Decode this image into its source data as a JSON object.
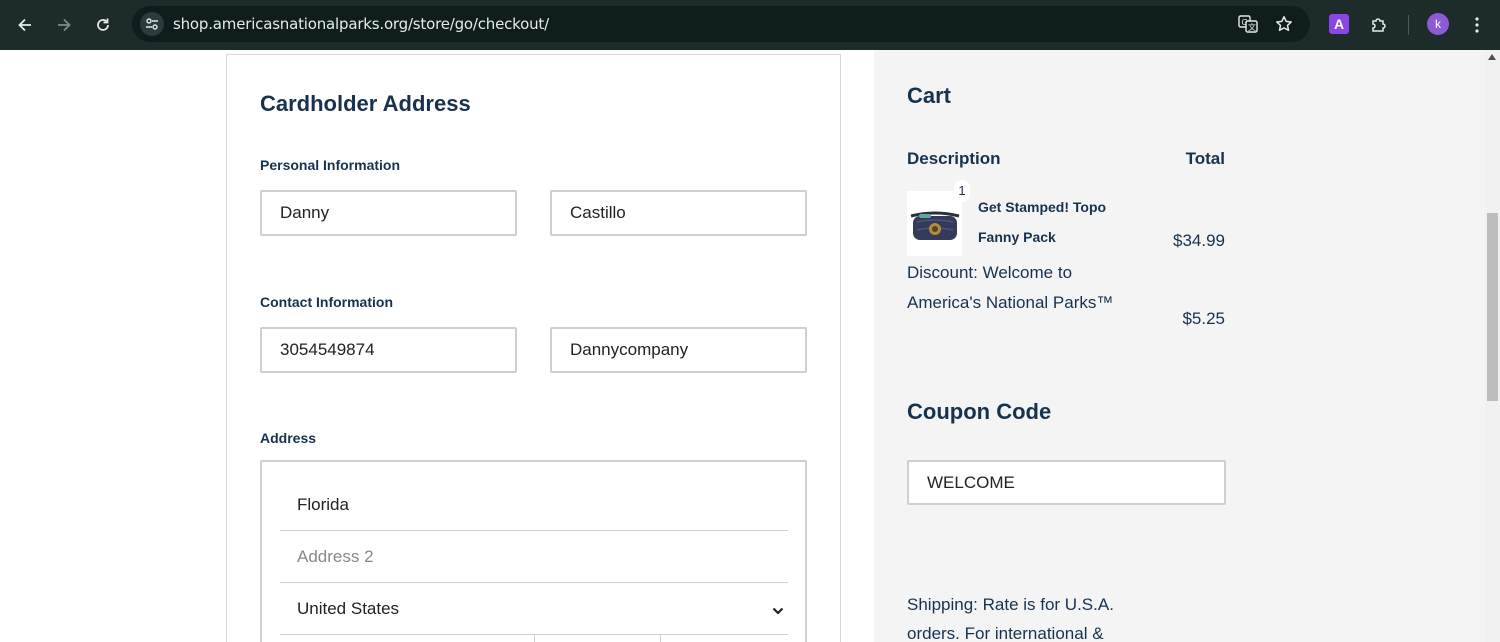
{
  "browser": {
    "url": "shop.americasnationalparks.org/store/go/checkout/",
    "extension_label": "A",
    "profile_initial": "k",
    "icons": [
      "back-icon",
      "forward-icon",
      "reload-icon",
      "site-info-icon",
      "translate-icon",
      "star-icon",
      "extensions-icon",
      "more-menu-icon"
    ]
  },
  "cardholder": {
    "title": "Cardholder Address",
    "personal_label": "Personal Information",
    "first_name": "Danny",
    "last_name": "Castillo",
    "contact_label": "Contact Information",
    "phone": "3054549874",
    "company": "Dannycompany",
    "address_label": "Address",
    "address1": "Florida",
    "address2_placeholder": "Address 2",
    "country": "United States"
  },
  "cart": {
    "title": "Cart",
    "description_header": "Description",
    "total_header": "Total",
    "item": {
      "quantity": "1",
      "name": "Get Stamped! Topo Fanny Pack",
      "price": "$34.99"
    },
    "discount_label": "Discount: Welcome to America's National Parks™",
    "discount_amount": "$5.25",
    "coupon_title": "Coupon Code",
    "coupon_value": "WELCOME",
    "shipping_note": "Shipping: Rate is for U.S.A. orders. For international &"
  }
}
